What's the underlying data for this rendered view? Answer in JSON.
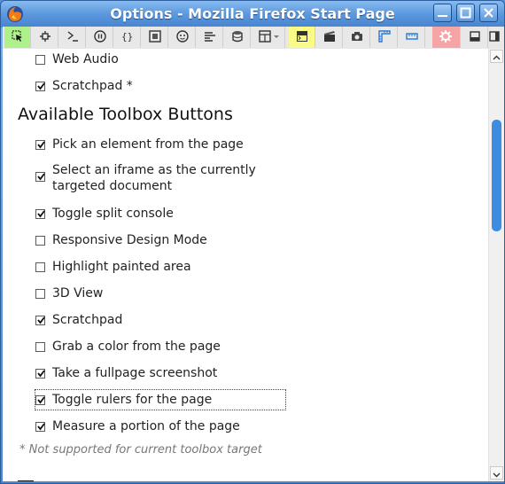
{
  "window": {
    "title": "Options - Mozilla Firefox Start Page",
    "controls": [
      "minimize",
      "maximize",
      "close"
    ]
  },
  "toolbar": {
    "buttons": [
      {
        "name": "pick-element-button",
        "icon": "cursor-pick-icon",
        "highlight": "#aef08a"
      },
      {
        "name": "debugger-button",
        "icon": "bug-icon"
      },
      {
        "name": "console-button",
        "icon": "console-prompt-icon"
      },
      {
        "name": "performance-button",
        "icon": "pause-circle-icon"
      },
      {
        "name": "style-editor-button",
        "icon": "braces-icon"
      },
      {
        "name": "frame-button",
        "icon": "frame-square-icon"
      },
      {
        "name": "memory-button",
        "icon": "face-icon"
      },
      {
        "name": "network-button",
        "icon": "network-lines-icon"
      },
      {
        "name": "storage-button",
        "icon": "database-icon"
      },
      {
        "name": "layout-dropdown-button",
        "icon": "grid-dropdown-icon"
      },
      {
        "name": "split-console-button",
        "icon": "terminal-icon",
        "highlight": "#fafa86"
      },
      {
        "name": "scratchpad-button",
        "icon": "clapper-icon"
      },
      {
        "name": "screenshot-button",
        "icon": "camera-icon"
      },
      {
        "name": "rulers-button",
        "icon": "ruler-corner-icon"
      },
      {
        "name": "measure-button",
        "icon": "ruler-icon"
      },
      {
        "name": "settings-button",
        "icon": "gear-icon",
        "highlight": "#f5a5a5"
      },
      {
        "name": "dock-bottom-button",
        "icon": "dock-bottom-icon"
      },
      {
        "name": "dock-side-button",
        "icon": "dock-side-icon"
      }
    ]
  },
  "options": {
    "top_items": [
      {
        "label": "Web Audio",
        "checked": false
      },
      {
        "label": "Scratchpad *",
        "checked": true
      }
    ],
    "toolbox_heading": "Available Toolbox Buttons",
    "toolbox_items": [
      {
        "label": "Pick an element from the page",
        "checked": true
      },
      {
        "label": "Select an iframe as the currently targeted document",
        "checked": true
      },
      {
        "label": "Toggle split console",
        "checked": true
      },
      {
        "label": "Responsive Design Mode",
        "checked": false
      },
      {
        "label": "Highlight painted area",
        "checked": false
      },
      {
        "label": "3D View",
        "checked": false
      },
      {
        "label": "Scratchpad",
        "checked": true
      },
      {
        "label": "Grab a color from the page",
        "checked": false
      },
      {
        "label": "Take a fullpage screenshot",
        "checked": true
      },
      {
        "label": "Toggle rulers for the page",
        "checked": true
      },
      {
        "label": "Measure a portion of the page",
        "checked": true
      }
    ],
    "footnote": "* Not supported for current toolbox target"
  },
  "colors": {
    "titlebar": "#5c98dd",
    "scroll_thumb": "#3c8ce0",
    "pick_highlight": "#aef08a",
    "console_highlight": "#fafa86",
    "settings_highlight": "#f5a5a5"
  }
}
